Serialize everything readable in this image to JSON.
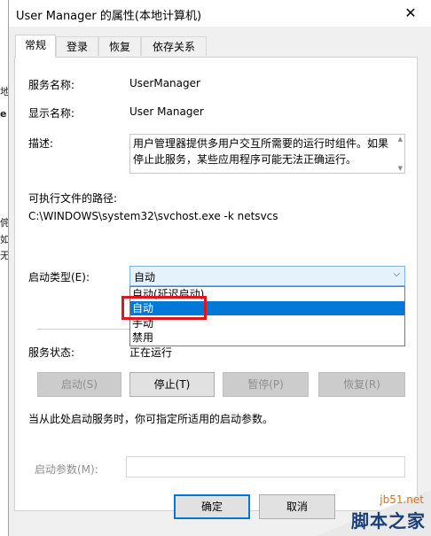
{
  "background_app": {
    "fragments": [
      "地",
      "e",
      "侂",
      "如",
      "无"
    ]
  },
  "window": {
    "title": "User Manager 的属性(本地计算机)",
    "close_glyph": "✕"
  },
  "tabs": [
    {
      "label": "常规",
      "active": true
    },
    {
      "label": "登录",
      "active": false
    },
    {
      "label": "恢复",
      "active": false
    },
    {
      "label": "依存关系",
      "active": false
    }
  ],
  "general": {
    "service_name_label": "服务名称:",
    "service_name_value": "UserManager",
    "display_name_label": "显示名称:",
    "display_name_value": "User Manager",
    "description_label": "描述:",
    "description_value": "用户管理器提供多用户交互所需要的运行时组件。如果停止此服务，某些应用程序可能无法正确运行。",
    "path_label": "可执行文件的路径:",
    "path_value": "C:\\WINDOWS\\system32\\svchost.exe -k netsvcs",
    "startup_type_label": "启动类型(E):",
    "startup_type_value": "自动",
    "startup_options": [
      {
        "label": "自动(延迟启动)",
        "selected": false
      },
      {
        "label": "自动",
        "selected": true
      },
      {
        "label": "手动",
        "selected": false
      },
      {
        "label": "禁用",
        "selected": false
      }
    ],
    "service_status_label": "服务状态:",
    "service_status_value": "正在运行",
    "control_buttons": [
      {
        "label": "启动(S)",
        "enabled": false
      },
      {
        "label": "停止(T)",
        "enabled": true
      },
      {
        "label": "暂停(P)",
        "enabled": false
      },
      {
        "label": "恢复(R)",
        "enabled": false
      }
    ],
    "hint_text": "当从此处启动服务时，你可指定所适用的启动参数。",
    "start_params_label": "启动参数(M):",
    "start_params_value": ""
  },
  "footer_buttons": {
    "ok": "确定",
    "cancel": "取消"
  },
  "watermark": {
    "url": "jb51.net",
    "name": "脚本之家"
  },
  "colors": {
    "highlight": "#0078d7",
    "annotation_red": "#e2141c",
    "select_bg": "#e5f1fb"
  }
}
